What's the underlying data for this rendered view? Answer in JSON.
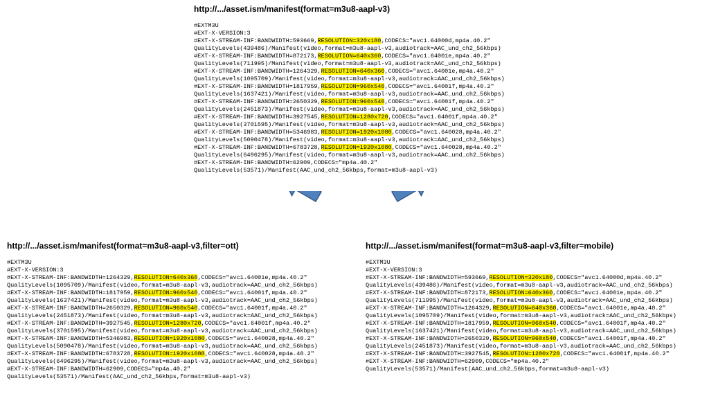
{
  "highlight_color": "#FFF200",
  "source": {
    "url": "http://.../asset.ism/manifest(format=m3u8-aapl-v3)",
    "lines": [
      [
        "#EXTM3U"
      ],
      [
        "#EXT-X-VERSION:3"
      ],
      [
        "#EXT-X-STREAM-INF:BANDWIDTH=593669,",
        {
          "hl": "RESOLUTION=320x180"
        },
        ",CODECS=\"avc1.64000d,mp4a.40.2\""
      ],
      [
        "QualityLevels(439486)/Manifest(video,format=m3u8-aapl-v3,audiotrack=AAC_und_ch2_56kbps)"
      ],
      [
        "#EXT-X-STREAM-INF:BANDWIDTH=872173,",
        {
          "hl": "RESOLUTION=640x360"
        },
        ",CODECS=\"avc1.64001e,mp4a.40.2\""
      ],
      [
        "QualityLevels(711995)/Manifest(video,format=m3u8-aapl-v3,audiotrack=AAC_und_ch2_56kbps)"
      ],
      [
        "#EXT-X-STREAM-INF:BANDWIDTH=1264329,",
        {
          "hl": "RESOLUTION=640x360"
        },
        ",CODECS=\"avc1.64001e,mp4a.40.2\""
      ],
      [
        "QualityLevels(1095709)/Manifest(video,format=m3u8-aapl-v3,audiotrack=AAC_und_ch2_56kbps)"
      ],
      [
        "#EXT-X-STREAM-INF:BANDWIDTH=1817959,",
        {
          "hl": "RESOLUTION=960x540"
        },
        ",CODECS=\"avc1.64001f,mp4a.40.2\""
      ],
      [
        "QualityLevels(1637421)/Manifest(video,format=m3u8-aapl-v3,audiotrack=AAC_und_ch2_56kbps)"
      ],
      [
        "#EXT-X-STREAM-INF:BANDWIDTH=2650329,",
        {
          "hl": "RESOLUTION=960x540"
        },
        ",CODECS=\"avc1.64001f,mp4a.40.2\""
      ],
      [
        "QualityLevels(2451873)/Manifest(video,format=m3u8-aapl-v3,audiotrack=AAC_und_ch2_56kbps)"
      ],
      [
        "#EXT-X-STREAM-INF:BANDWIDTH=3927545,",
        {
          "hl": "RESOLUTION=1280x720"
        },
        ",CODECS=\"avc1.64001f,mp4a.40.2\""
      ],
      [
        "QualityLevels(3701595)/Manifest(video,format=m3u8-aapl-v3,audiotrack=AAC_und_ch2_56kbps)"
      ],
      [
        "#EXT-X-STREAM-INF:BANDWIDTH=5346983,",
        {
          "hl": "RESOLUTION=1920x1080"
        },
        ",CODECS=\"avc1.640028,mp4a.40.2\""
      ],
      [
        "QualityLevels(5090478)/Manifest(video,format=m3u8-aapl-v3,audiotrack=AAC_und_ch2_56kbps)"
      ],
      [
        "#EXT-X-STREAM-INF:BANDWIDTH=6783728,",
        {
          "hl": "RESOLUTION=1920x1080"
        },
        ",CODECS=\"avc1.640028,mp4a.40.2\""
      ],
      [
        "QualityLevels(6496295)/Manifest(video,format=m3u8-aapl-v3,audiotrack=AAC_und_ch2_56kbps)"
      ],
      [
        "#EXT-X-STREAM-INF:BANDWIDTH=62909,CODECS=\"mp4a.40.2\""
      ],
      [
        "QualityLevels(53571)/Manifest(AAC_und_ch2_56kbps,format=m3u8-aapl-v3)"
      ]
    ]
  },
  "ott": {
    "url": "http://.../asset.ism/manifest(format=m3u8-aapl-v3,filter=ott)",
    "lines": [
      [
        "#EXTM3U"
      ],
      [
        "#EXT-X-VERSION:3"
      ],
      [
        "#EXT-X-STREAM-INF:BANDWIDTH=1264329,",
        {
          "hl": "RESOLUTION=640x360"
        },
        ",CODECS=\"avc1.64001e,mp4a.40.2\""
      ],
      [
        "QualityLevels(1095709)/Manifest(video,format=m3u8-aapl-v3,audiotrack=AAC_und_ch2_56kbps)"
      ],
      [
        "#EXT-X-STREAM-INF:BANDWIDTH=1817959,",
        {
          "hl": "RESOLUTION=960x540"
        },
        ",CODECS=\"avc1.64001f,mp4a.40.2\""
      ],
      [
        "QualityLevels(1637421)/Manifest(video,format=m3u8-aapl-v3,audiotrack=AAC_und_ch2_56kbps)"
      ],
      [
        "#EXT-X-STREAM-INF:BANDWIDTH=2650329,",
        {
          "hl": "RESOLUTION=960x540"
        },
        ",CODECS=\"avc1.64001f,mp4a.40.2\""
      ],
      [
        "QualityLevels(2451873)/Manifest(video,format=m3u8-aapl-v3,audiotrack=AAC_und_ch2_56kbps)"
      ],
      [
        "#EXT-X-STREAM-INF:BANDWIDTH=3927545,",
        {
          "hl": "RESOLUTION=1280x720"
        },
        ",CODECS=\"avc1.64001f,mp4a.40.2\""
      ],
      [
        "QualityLevels(3701595)/Manifest(video,format=m3u8-aapl-v3,audiotrack=AAC_und_ch2_56kbps)"
      ],
      [
        "#EXT-X-STREAM-INF:BANDWIDTH=5346983,",
        {
          "hl": "RESOLUTION=1920x1080"
        },
        ",CODECS=\"avc1.640028,mp4a.40.2\""
      ],
      [
        "QualityLevels(5090478)/Manifest(video,format=m3u8-aapl-v3,audiotrack=AAC_und_ch2_56kbps)"
      ],
      [
        "#EXT-X-STREAM-INF:BANDWIDTH=6783728,",
        {
          "hl": "RESOLUTION=1920x1080"
        },
        ",CODECS=\"avc1.640028,mp4a.40.2\""
      ],
      [
        "QualityLevels(6496295)/Manifest(video,format=m3u8-aapl-v3,audiotrack=AAC_und_ch2_56kbps)"
      ],
      [
        "#EXT-X-STREAM-INF:BANDWIDTH=62909,CODECS=\"mp4a.40.2\""
      ],
      [
        "QualityLevels(53571)/Manifest(AAC_und_ch2_56kbps,format=m3u8-aapl-v3)"
      ]
    ]
  },
  "mobile": {
    "url": "http://.../asset.ism/manifest(format=m3u8-aapl-v3,filter=mobile)",
    "lines": [
      [
        "#EXTM3U"
      ],
      [
        "#EXT-X-VERSION:3"
      ],
      [
        "#EXT-X-STREAM-INF:BANDWIDTH=593669,",
        {
          "hl": "RESOLUTION=320x180"
        },
        ",CODECS=\"avc1.64000d,mp4a.40.2\""
      ],
      [
        "QualityLevels(439486)/Manifest(video,format=m3u8-aapl-v3,audiotrack=AAC_und_ch2_56kbps)"
      ],
      [
        "#EXT-X-STREAM-INF:BANDWIDTH=872173,",
        {
          "hl": "RESOLUTION=640x360"
        },
        ",CODECS=\"avc1.64001e,mp4a.40.2\""
      ],
      [
        "QualityLevels(711995)/Manifest(video,format=m3u8-aapl-v3,audiotrack=AAC_und_ch2_56kbps)"
      ],
      [
        "#EXT-X-STREAM-INF:BANDWIDTH=1264329,",
        {
          "hl": "RESOLUTION=640x360"
        },
        ",CODECS=\"avc1.64001e,mp4a.40.2\""
      ],
      [
        "QualityLevels(1095709)/Manifest(video,format=m3u8-aapl-v3,audiotrack=AAC_und_ch2_56kbps)"
      ],
      [
        "#EXT-X-STREAM-INF:BANDWIDTH=1817959,",
        {
          "hl": "RESOLUTION=960x540"
        },
        ",CODECS=\"avc1.64001f,mp4a.40.2\""
      ],
      [
        "QualityLevels(1637421)/Manifest(video,format=m3u8-aapl-v3,audiotrack=AAC_und_ch2_56kbps)"
      ],
      [
        "#EXT-X-STREAM-INF:BANDWIDTH=2650329,",
        {
          "hl": "RESOLUTION=960x540"
        },
        ",CODECS=\"avc1.64001f,mp4a.40.2\""
      ],
      [
        "QualityLevels(2451873)/Manifest(video,format=m3u8-aapl-v3,audiotrack=AAC_und_ch2_56kbps)"
      ],
      [
        "#EXT-X-STREAM-INF:BANDWIDTH=3927545,",
        {
          "hl": "RESOLUTION=1280x720"
        },
        ",CODECS=\"avc1.64001f,mp4a.40.2\""
      ],
      [
        "#EXT-X-STREAM-INF:BANDWIDTH=62909,CODECS=\"mp4a.40.2\""
      ],
      [
        "QualityLevels(53571)/Manifest(AAC_und_ch2_56kbps,format=m3u8-aapl-v3)"
      ]
    ]
  }
}
